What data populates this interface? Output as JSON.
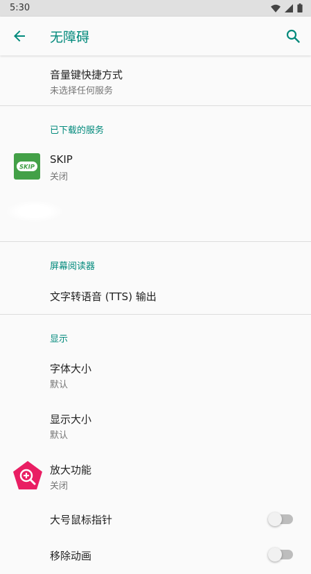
{
  "status_bar": {
    "time": "5:30"
  },
  "app_bar": {
    "title": "无障碍"
  },
  "items": {
    "volume_shortcut": {
      "title": "音量键快捷方式",
      "summary": "未选择任何服务"
    },
    "skip": {
      "title": "SKIP",
      "summary": "关闭",
      "icon_text": "SKIP"
    },
    "tts": {
      "title": "文字转语音 (TTS) 输出"
    },
    "font_size": {
      "title": "字体大小",
      "summary": "默认"
    },
    "display_size": {
      "title": "显示大小",
      "summary": "默认"
    },
    "magnification": {
      "title": "放大功能",
      "summary": "关闭"
    },
    "large_pointer": {
      "title": "大号鼠标指针",
      "checked": false
    },
    "remove_animations": {
      "title": "移除动画",
      "checked": false
    }
  },
  "sections": {
    "downloaded_services": "已下载的服务",
    "screen_readers": "屏幕阅读器",
    "display": "显示"
  },
  "colors": {
    "accent": "#00897b",
    "skip_icon_bg": "#43a047",
    "magnify_icon_bg": "#e91e63"
  }
}
